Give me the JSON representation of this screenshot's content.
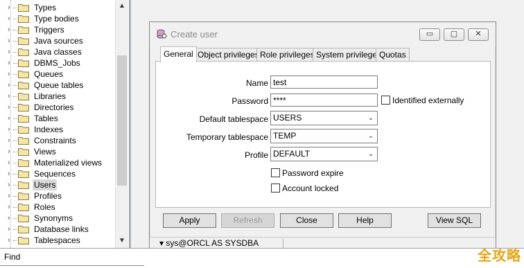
{
  "tree": {
    "items": [
      {
        "label": "Types"
      },
      {
        "label": "Type bodies"
      },
      {
        "label": "Triggers"
      },
      {
        "label": "Java sources"
      },
      {
        "label": "Java classes"
      },
      {
        "label": "DBMS_Jobs"
      },
      {
        "label": "Queues"
      },
      {
        "label": "Queue tables"
      },
      {
        "label": "Libraries"
      },
      {
        "label": "Directories"
      },
      {
        "label": "Tables"
      },
      {
        "label": "Indexes"
      },
      {
        "label": "Constraints"
      },
      {
        "label": "Views"
      },
      {
        "label": "Materialized views"
      },
      {
        "label": "Sequences"
      },
      {
        "label": "Users",
        "selected": true
      },
      {
        "label": "Profiles"
      },
      {
        "label": "Roles"
      },
      {
        "label": "Synonyms"
      },
      {
        "label": "Database links"
      },
      {
        "label": "Tablespaces"
      }
    ],
    "scroll_up_glyph": "▲",
    "scroll_down_glyph": "▼",
    "expander_glyph": "›"
  },
  "dialog": {
    "title": "Create user",
    "title_icon": "database-user-icon",
    "minimize_glyph": "▭",
    "maximize_glyph": "▢",
    "close_glyph": "✕",
    "tabs": [
      {
        "label": "General",
        "active": true
      },
      {
        "label": "Object privileges"
      },
      {
        "label": "Role privileges"
      },
      {
        "label": "System privileges"
      },
      {
        "label": "Quotas"
      }
    ],
    "form": {
      "name_label": "Name",
      "name_value": "test",
      "password_label": "Password",
      "password_value": "****",
      "identified_externally_label": "Identified externally",
      "default_tablespace_label": "Default tablespace",
      "default_tablespace_value": "USERS",
      "temporary_tablespace_label": "Temporary tablespace",
      "temporary_tablespace_value": "TEMP",
      "profile_label": "Profile",
      "profile_value": "DEFAULT",
      "password_expire_label": "Password expire",
      "account_locked_label": "Account locked"
    },
    "buttons": {
      "apply": "Apply",
      "refresh": "Refresh",
      "close": "Close",
      "help": "Help",
      "view_sql": "View SQL"
    },
    "status": {
      "connection": "sys@ORCL AS SYSDBA",
      "connection_glyph": "▾"
    }
  },
  "find_bar": {
    "label": "Find"
  },
  "watermark": {
    "text": "全攻略"
  },
  "colors": {
    "selection": "#d9d9d9",
    "folder": "#f5e6a6",
    "watermark": "#e8a516",
    "mdi_background": "#abb3bc"
  }
}
